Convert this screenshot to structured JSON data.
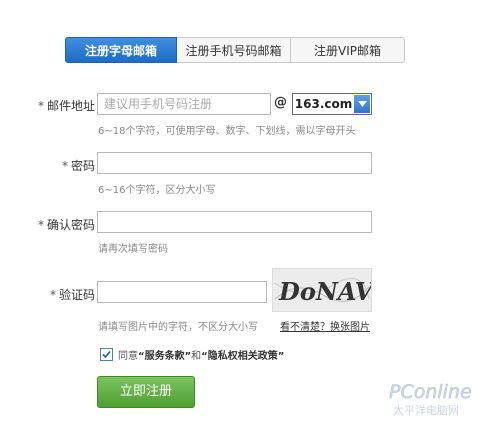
{
  "tabs": [
    {
      "label": "注册字母邮箱",
      "active": true
    },
    {
      "label": "注册手机号码邮箱",
      "active": false
    },
    {
      "label": "注册VIP邮箱",
      "active": false
    }
  ],
  "email": {
    "label": "邮件地址",
    "star": "*",
    "placeholder": "建议用手机号码注册",
    "at": "@",
    "domain": "163.com",
    "hint": "6~18个字符，可使用字母、数字、下划线，需以字母开头"
  },
  "password": {
    "label": "密码",
    "star": "*",
    "hint": "6~16个字符，区分大小写"
  },
  "confirm": {
    "label": "确认密码",
    "star": "*",
    "hint": "请再次填写密码"
  },
  "captcha": {
    "label": "验证码",
    "star": "*",
    "hint": "请填写图片中的字符，不区分大小写",
    "refresh": "看不清楚？换张图片",
    "image_text": "DoNAVT"
  },
  "agreement": {
    "prefix": "同意",
    "service_terms": "“服务条款”",
    "and": "和",
    "privacy": "“隐私权相关政策”",
    "checked": true
  },
  "submit_label": "立即注册",
  "watermark": {
    "brand": "PConline",
    "sub": "太平洋电脑网"
  },
  "colors": {
    "tab_active": "#2b7bd3",
    "submit_green": "#5aab3c"
  }
}
